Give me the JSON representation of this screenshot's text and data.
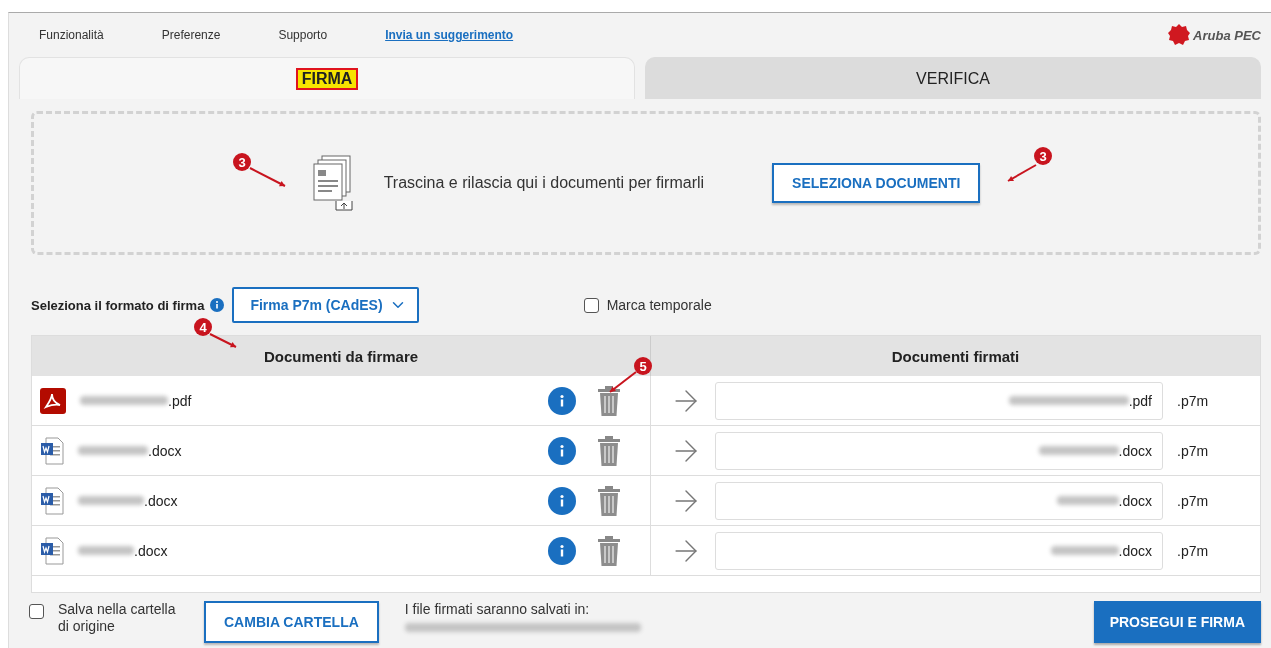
{
  "menu": [
    {
      "label": "Funzionalità",
      "kind": "menu"
    },
    {
      "label": "Preferenze",
      "kind": "menu"
    },
    {
      "label": "Supporto",
      "kind": "menu"
    },
    {
      "label": "Invia un suggerimento",
      "kind": "link"
    }
  ],
  "logo": {
    "text": "Aruba PEC"
  },
  "tabs": [
    {
      "label": "FIRMA",
      "selected": true,
      "highlighted": true
    },
    {
      "label": "VERIFICA",
      "selected": false,
      "highlighted": false
    }
  ],
  "dropzone": {
    "text": "Trascina e rilascia qui i documenti per firmarli",
    "button": "SELEZIONA DOCUMENTI"
  },
  "format": {
    "label": "Seleziona il formato di firma",
    "value": "Firma P7m (CAdES)"
  },
  "timestamp": {
    "label": "Marca temporale",
    "checked": false
  },
  "table": {
    "columns": [
      "Documenti da firmare",
      "Documenti firmati"
    ],
    "rows": [
      {
        "kind": "pdf",
        "source": ".pdf",
        "target": ".pdf",
        "suffix": ".p7m"
      },
      {
        "kind": "docx",
        "source": ".docx",
        "target": ".docx",
        "suffix": ".p7m"
      },
      {
        "kind": "docx",
        "source": ".docx",
        "target": ".docx",
        "suffix": ".p7m"
      },
      {
        "kind": "docx",
        "source": ".docx",
        "target": ".docx",
        "suffix": ".p7m"
      }
    ]
  },
  "footer": {
    "save_origin": {
      "label": "Salva nella cartella di origine",
      "checked": false
    },
    "change_button": "CAMBIA CARTELLA",
    "save_path_label": "I file firmati saranno salvati in:",
    "submit": "PROSEGUI E FIRMA"
  },
  "annotations": [
    {
      "number": "3"
    },
    {
      "number": "3"
    },
    {
      "number": "4"
    },
    {
      "number": "5"
    }
  ]
}
